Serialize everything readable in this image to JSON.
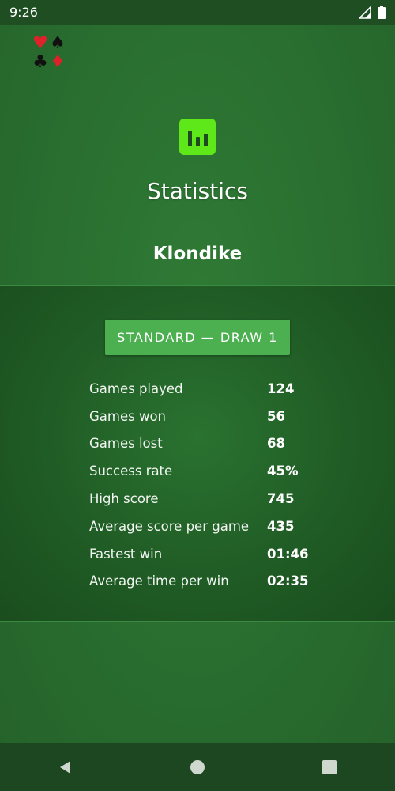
{
  "status_bar": {
    "time": "9:26",
    "icons": [
      "signal-icon",
      "battery-icon"
    ]
  },
  "header": {
    "suits": [
      {
        "glyph": "♥",
        "name": "heart-suit-icon",
        "color": "#e0202a"
      },
      {
        "glyph": "♠",
        "name": "spade-suit-icon",
        "color": "#111111"
      },
      {
        "glyph": "♣",
        "name": "club-suit-icon",
        "color": "#111111"
      },
      {
        "glyph": "♦",
        "name": "diamond-suit-icon",
        "color": "#e0202a"
      }
    ],
    "icon": "bar-chart-icon",
    "title": "Statistics",
    "game": "Klondike"
  },
  "panel": {
    "mode_button": "STANDARD — DRAW 1",
    "stats": [
      {
        "label": "Games played",
        "value": "124"
      },
      {
        "label": "Games won",
        "value": "56"
      },
      {
        "label": "Games lost",
        "value": "68"
      },
      {
        "label": "Success rate",
        "value": "45%"
      },
      {
        "label": "High score",
        "value": "745"
      },
      {
        "label": "Average score per game",
        "value": "435"
      },
      {
        "label": "Fastest win",
        "value": "01:46"
      },
      {
        "label": "Average time per win",
        "value": "02:35"
      }
    ]
  },
  "nav_bar": {
    "buttons": [
      "back-icon",
      "home-icon",
      "recents-icon"
    ]
  },
  "colors": {
    "accent": "#5ee819",
    "button": "#4caf50",
    "background": "#2a6a31"
  }
}
